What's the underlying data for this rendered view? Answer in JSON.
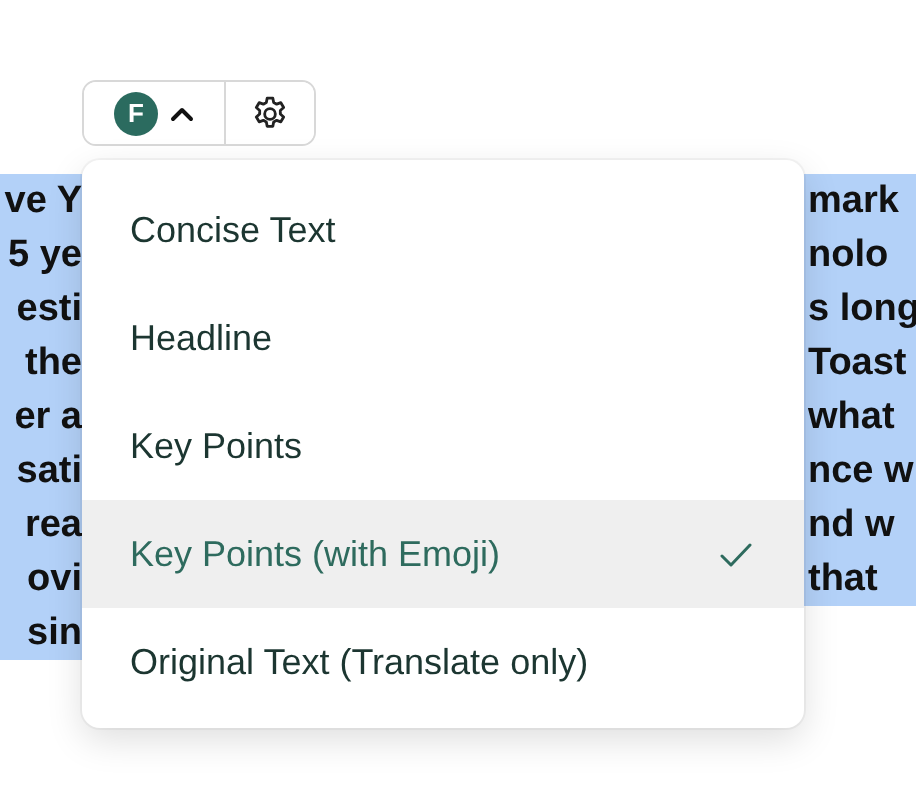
{
  "toolbar": {
    "logo_letter": "F"
  },
  "document": {
    "lines": [
      {
        "left": "ve Y",
        "right": "mark",
        "selected": true
      },
      {
        "left": "5 ye",
        "right": "nolo",
        "selected": true
      },
      {
        "left": "esti",
        "right": "s long",
        "selected": true
      },
      {
        "left": "the",
        "right": "Toast",
        "selected": true
      },
      {
        "left": "er a",
        "right": "what",
        "selected": true
      },
      {
        "left": "sati",
        "right": "nce w",
        "selected": true
      },
      {
        "left": "rea",
        "right": "nd w",
        "selected": true
      },
      {
        "left": "ovi",
        "right": "that",
        "selected": true
      },
      {
        "left": "sin",
        "selected": true
      }
    ]
  },
  "menu": {
    "items": [
      {
        "label": "Concise Text",
        "selected": false
      },
      {
        "label": "Headline",
        "selected": false
      },
      {
        "label": "Key Points",
        "selected": false
      },
      {
        "label": "Key Points (with Emoji)",
        "selected": true
      },
      {
        "label": "Original Text (Translate only)",
        "selected": false
      }
    ]
  }
}
